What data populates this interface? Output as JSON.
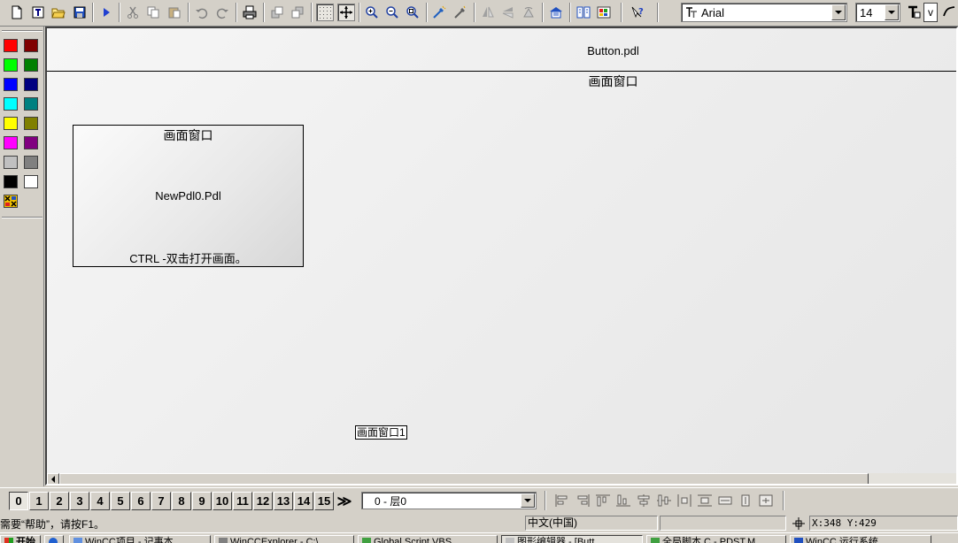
{
  "toolbar": {
    "font_name": "Arial",
    "font_size": "14",
    "extra_button_label": "v"
  },
  "palette": {
    "colors": [
      "#ff0000",
      "#800000",
      "#00ff00",
      "#008000",
      "#0000ff",
      "#000080",
      "#00ffff",
      "#008080",
      "#ffff00",
      "#808000",
      "#ff00ff",
      "#800080",
      "#c0c0c0",
      "#808080",
      "#000000",
      "#ffffff"
    ]
  },
  "canvas": {
    "file_title": "Button.pdl",
    "subtitle": "画面窗口",
    "pdl_box": {
      "title": "画面窗口",
      "name": "NewPdl0.Pdl",
      "hint": "CTRL -双击打开画面。"
    },
    "pdl_label": "画面窗口1"
  },
  "layerbar": {
    "layers": [
      "0",
      "1",
      "2",
      "3",
      "4",
      "5",
      "6",
      "7",
      "8",
      "9",
      "10",
      "11",
      "12",
      "13",
      "14",
      "15"
    ],
    "more": "≫",
    "layer_select": "0 - 层0"
  },
  "statusbar": {
    "help": "需要“帮助”，请按F1。",
    "language": "中文(中国)",
    "coords": "X:348 Y:429"
  },
  "taskbar": {
    "start": "开始",
    "tasks": [
      "WinCC项目 - 记事本",
      "WinCCExplorer - C:\\...",
      "Global Script VBS...",
      "图形编辑器 - [Butt...",
      "全局脚本 C - PDST.M...",
      "WinCC 运行系统"
    ]
  }
}
